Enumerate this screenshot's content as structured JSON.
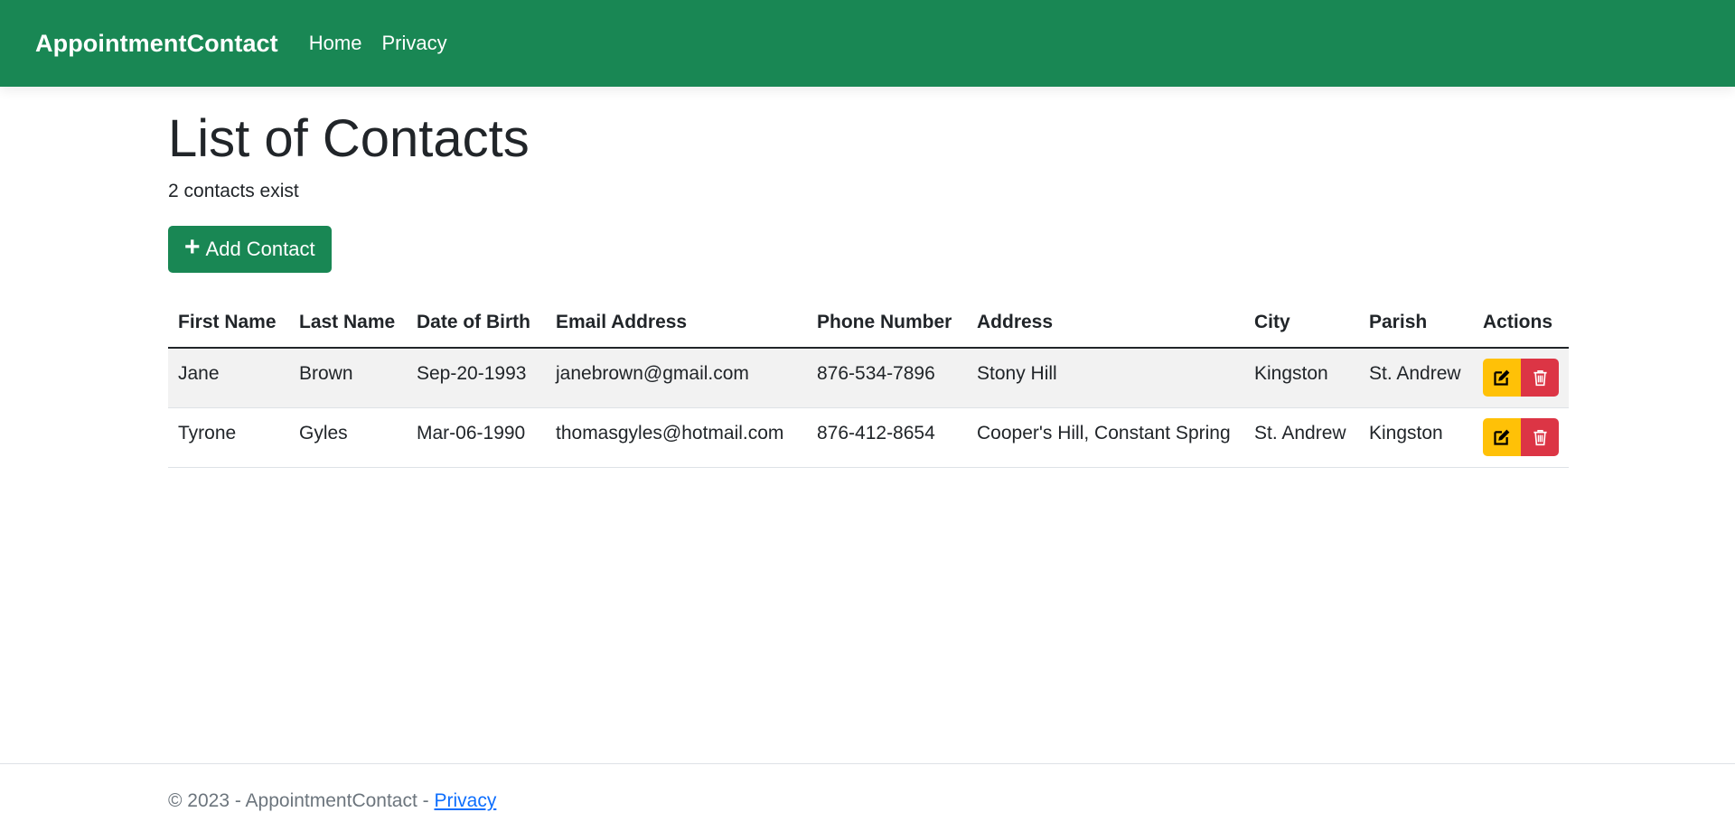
{
  "navbar": {
    "brand": "AppointmentContact",
    "links": [
      "Home",
      "Privacy"
    ],
    "background": "#198754"
  },
  "main": {
    "title": "List of Contacts",
    "count_text": "2 contacts exist",
    "add_button": {
      "icon": "plus-icon",
      "label": "Add Contact"
    }
  },
  "table": {
    "headers": {
      "first_name": "First Name",
      "last_name": "Last Name",
      "dob": "Date of Birth",
      "email": "Email Address",
      "phone": "Phone Number",
      "address": "Address",
      "city": "City",
      "parish": "Parish",
      "actions": "Actions"
    },
    "rows": [
      {
        "first_name": "Jane",
        "last_name": "Brown",
        "dob": "Sep-20-1993",
        "email": "janebrown@gmail.com",
        "phone": "876-534-7896",
        "address": "Stony Hill",
        "city": "Kingston",
        "parish": "St. Andrew"
      },
      {
        "first_name": "Tyrone",
        "last_name": "Gyles",
        "dob": "Mar-06-1990",
        "email": "thomasgyles@hotmail.com",
        "phone": "876-412-8654",
        "address": "Cooper's Hill, Constant Spring",
        "city": "St. Andrew",
        "parish": "Kingston"
      }
    ],
    "action_icons": [
      "edit-icon",
      "trash-icon"
    ],
    "colors": {
      "edit": "#ffc107",
      "delete": "#dc3545"
    }
  },
  "footer": {
    "text": "© 2023 - AppointmentContact - ",
    "link": "Privacy"
  }
}
